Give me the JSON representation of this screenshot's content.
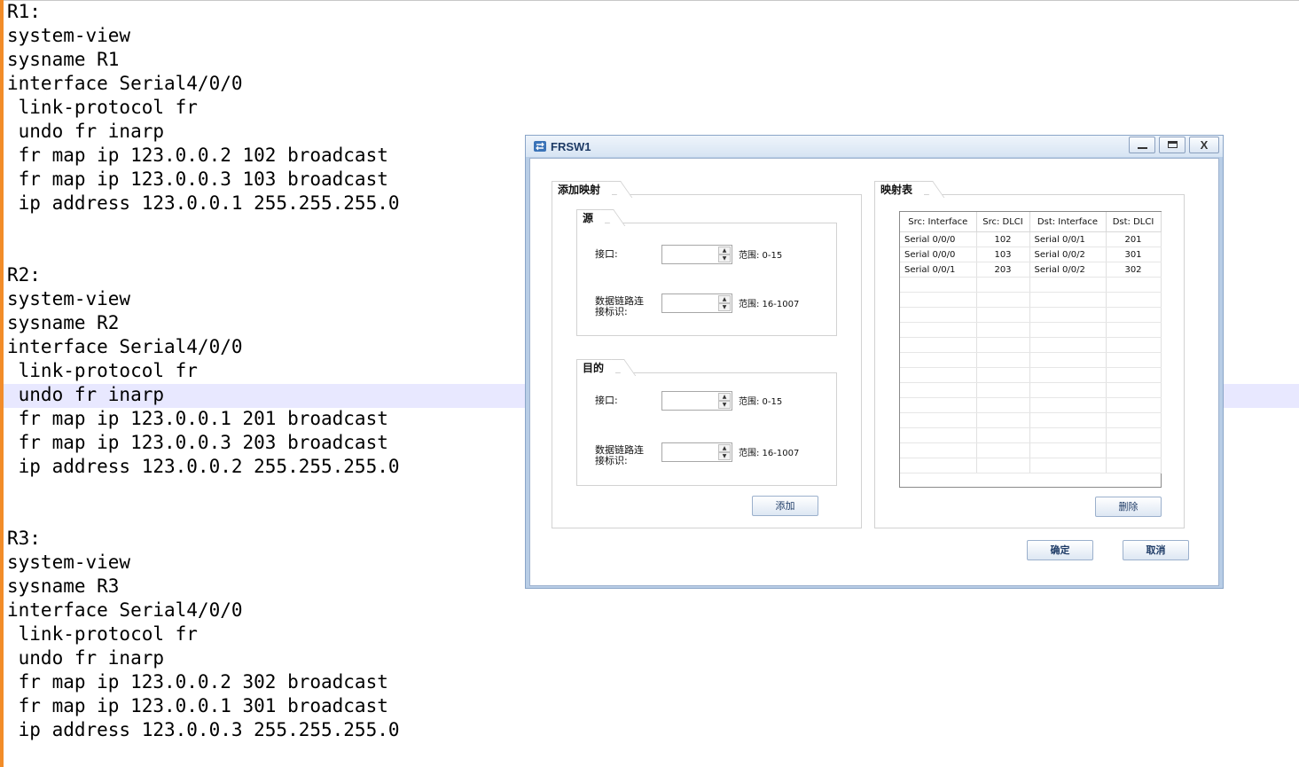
{
  "editor": {
    "lines": [
      "R1:",
      "system-view",
      "sysname R1",
      "interface Serial4/0/0",
      " link-protocol fr",
      " undo fr inarp",
      " fr map ip 123.0.0.2 102 broadcast",
      " fr map ip 123.0.0.3 103 broadcast",
      " ip address 123.0.0.1 255.255.255.0",
      "",
      "",
      "R2:",
      "system-view",
      "sysname R2",
      "interface Serial4/0/0",
      " link-protocol fr",
      " undo fr inarp",
      " fr map ip 123.0.0.1 201 broadcast",
      " fr map ip 123.0.0.3 203 broadcast",
      " ip address 123.0.0.2 255.255.255.0",
      "",
      "",
      "R3:",
      "system-view",
      "sysname R3",
      "interface Serial4/0/0",
      " link-protocol fr",
      " undo fr inarp",
      " fr map ip 123.0.0.2 302 broadcast",
      " fr map ip 123.0.0.1 301 broadcast",
      " ip address 123.0.0.3 255.255.255.0"
    ]
  },
  "dialog": {
    "title": "FRSW1",
    "close_label": "X",
    "add_group": {
      "title": "添加映射",
      "source": {
        "title": "源",
        "interface_label": "接口:",
        "interface_range": "范围: 0-15",
        "interface_value": "",
        "dlci_label": "数据链路连接标识:",
        "dlci_range": "范围: 16-1007",
        "dlci_value": ""
      },
      "destination": {
        "title": "目的",
        "interface_label": "接口:",
        "interface_range": "范围: 0-15",
        "interface_value": "",
        "dlci_label": "数据链路连接标识:",
        "dlci_range": "范围: 16-1007",
        "dlci_value": ""
      },
      "add_button": "添加"
    },
    "map_group": {
      "title": "映射表",
      "columns": [
        "Src: Interface",
        "Src: DLCI",
        "Dst: Interface",
        "Dst: DLCI"
      ],
      "rows": [
        [
          "Serial 0/0/0",
          "102",
          "Serial 0/0/1",
          "201"
        ],
        [
          "Serial 0/0/0",
          "103",
          "Serial 0/0/2",
          "301"
        ],
        [
          "Serial 0/0/1",
          "203",
          "Serial 0/0/2",
          "302"
        ]
      ],
      "delete_button": "删除"
    },
    "ok_button": "确定",
    "cancel_button": "取消"
  },
  "colors": {
    "margin_accent": "#f28c28",
    "line_highlight": "#e8e8ff",
    "dialog_frame": "#b8cde6"
  }
}
